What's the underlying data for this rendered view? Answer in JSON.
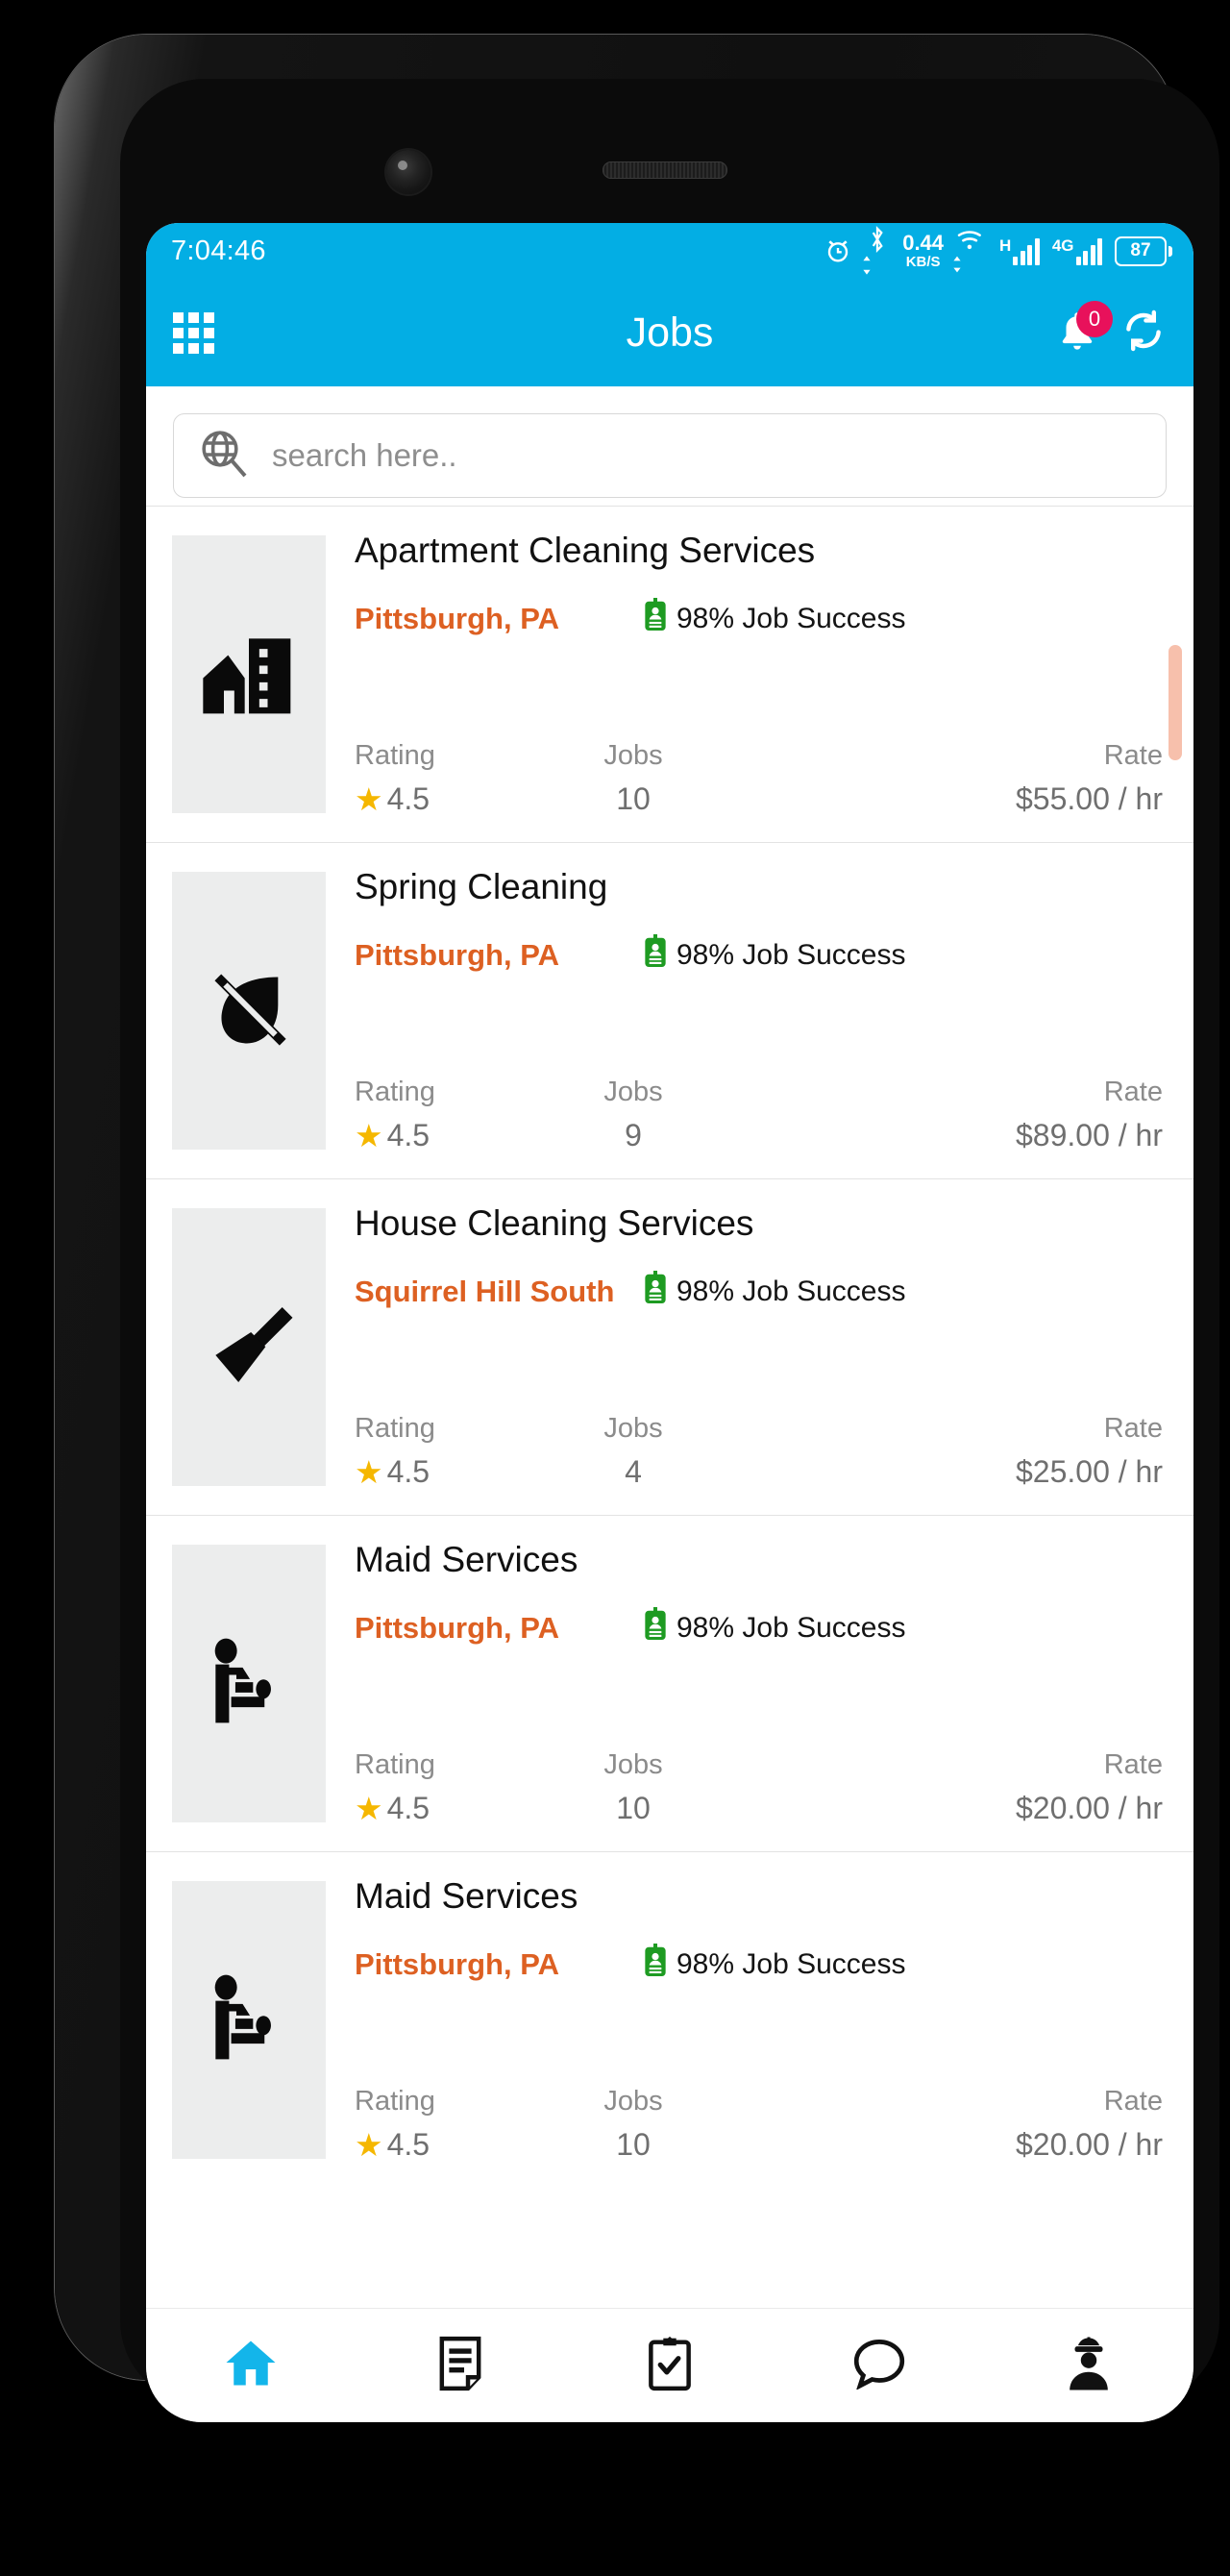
{
  "device": {
    "camera_icon": "front-camera-lens",
    "earpiece_icon": "earpiece-speaker"
  },
  "status_bar": {
    "time": "7:04:46",
    "alarm_icon": "alarm-clock-icon",
    "bluetooth_icon": "bluetooth-icon",
    "net_speed_value": "0.44",
    "net_speed_unit": "KB/S",
    "wifi_icon": "wifi-icon",
    "signal1_label": "H",
    "signal2_label": "4G",
    "battery_level": "87"
  },
  "app_bar": {
    "menu_icon": "grid-menu-icon",
    "title": "Jobs",
    "bell_icon": "notification-bell-icon",
    "notification_count": "0",
    "refresh_icon": "refresh-icon"
  },
  "search": {
    "icon": "globe-search-icon",
    "placeholder": "search here.."
  },
  "labels": {
    "rating": "Rating",
    "jobs": "Jobs",
    "rate": "Rate"
  },
  "jobs": [
    {
      "icon": "apartment-building-icon",
      "title": "Apartment Cleaning Services",
      "location": "Pittsburgh, PA",
      "success": "98% Job Success",
      "success_icon": "green-id-badge-icon",
      "rating": "4.5",
      "jobs_count": "10",
      "rate": "$55.00 / hr"
    },
    {
      "icon": "leaf-crossed-out-icon",
      "title": "Spring Cleaning",
      "location": "Pittsburgh, PA",
      "success": "98% Job Success",
      "success_icon": "green-id-badge-icon",
      "rating": "4.5",
      "jobs_count": "9",
      "rate": "$89.00 / hr"
    },
    {
      "icon": "broom-icon",
      "title": "House Cleaning Services",
      "location": "Squirrel Hill South",
      "success": "98% Job Success",
      "success_icon": "green-id-badge-icon",
      "rating": "4.5",
      "jobs_count": "4",
      "rate": "$25.00 / hr"
    },
    {
      "icon": "baby-changing-icon",
      "title": "Maid Services",
      "location": "Pittsburgh, PA",
      "success": "98% Job Success",
      "success_icon": "green-id-badge-icon",
      "rating": "4.5",
      "jobs_count": "10",
      "rate": "$20.00 / hr"
    },
    {
      "icon": "baby-changing-icon",
      "title": "Maid Services",
      "location": "Pittsburgh, PA",
      "success": "98% Job Success",
      "success_icon": "green-id-badge-icon",
      "rating": "4.5",
      "jobs_count": "10",
      "rate": "$20.00 / hr"
    }
  ],
  "bottom_nav": [
    {
      "icon": "home-icon",
      "active": true
    },
    {
      "icon": "document-notes-icon",
      "active": false
    },
    {
      "icon": "clipboard-check-icon",
      "active": false
    },
    {
      "icon": "chat-bubble-icon",
      "active": false
    },
    {
      "icon": "worker-profile-icon",
      "active": false
    }
  ],
  "colors": {
    "accent_blue": "#03AEE4",
    "location_orange": "#DD6022",
    "badge_red": "#E8115B",
    "success_green": "#1E9B22",
    "star_yellow": "#F5B700",
    "scrollbar": "#F7C0AC"
  }
}
